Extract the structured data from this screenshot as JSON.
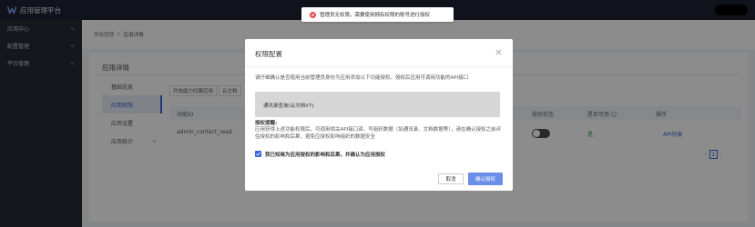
{
  "header": {
    "title": "应用管理平台"
  },
  "sidebar": {
    "items": [
      {
        "label": "应用中心"
      },
      {
        "label": "配置管理"
      },
      {
        "label": "平台管理"
      }
    ]
  },
  "breadcrumb": {
    "items": [
      "表格管理",
      "应用详情"
    ],
    "separator": ">"
  },
  "app_detail": {
    "title": "应用详情",
    "subnav": [
      {
        "label": "基础信息"
      },
      {
        "label": "应用权限"
      },
      {
        "label": "应用设置"
      },
      {
        "label": "应用统计"
      }
    ],
    "tabs": [
      "开放能力归属应用",
      "云文档"
    ],
    "table": {
      "columns": [
        "功能ID",
        "授权状态",
        "是否可用",
        "操作"
      ],
      "rows": [
        {
          "id": "admin_contact_read",
          "available": "是",
          "action": "API列表"
        }
      ]
    },
    "pagination": {
      "current": "1"
    }
  },
  "toast": {
    "message": "管理员无权限，需要使用拥有权限的账号进行授权"
  },
  "dialog": {
    "title": "权限配置",
    "description": "请仔细确认是否使用当前管理员身份为应用添加以下功能授权，授权后应用可调用功能的API接口",
    "permission": "通讯录查询(云文档V7)",
    "warning_title": "授权提醒:",
    "warning_text": "应用获得上述功能权限后，可调用相关API接口读、写组织数据（如通讯录、文档数据等），请在确认授权之前评估授权的影响和后果，避免应授权影响组织的数据安全",
    "checkbox_label": "我已知晓为应用授权的影响和后果，并确认为应用授权",
    "cancel": "取消",
    "confirm": "确认授权"
  },
  "colors": {
    "primary": "#3b66d6",
    "topbar": "#1f2433",
    "sidebar": "#252a38",
    "error": "#e5484d",
    "success": "#2e9b4a"
  },
  "icons": {
    "logo": "w-logo-icon",
    "close": "close-icon",
    "error": "error-circle-icon",
    "check": "check-icon",
    "chevron": "chevron-down-icon"
  }
}
